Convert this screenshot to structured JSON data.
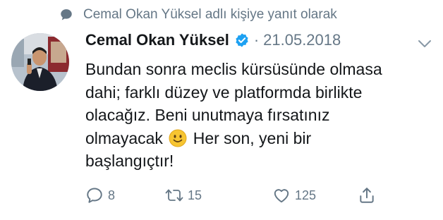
{
  "context": {
    "text": "Cemal Okan Yüksel adlı kişiye yanıt olarak",
    "icon": "speech-bubble-icon"
  },
  "tweet": {
    "author": "Cemal Okan Yüksel",
    "verified": true,
    "separator": "·",
    "date": "21.05.2018",
    "text_before_emoji": "Bundan sonra meclis kürsüsünde olmasa\ndahi; farklı düzey ve platformda birlikte\nolacağız. Beni unutmaya fırsatınız\nolmayacak ",
    "emoji": "slightly-smiling-face-icon",
    "text_after_emoji": " Her son, yeni bir\nbaşlangıçtır!"
  },
  "actions": {
    "reply_count": "8",
    "retweet_count": "15",
    "like_count": "125"
  },
  "colors": {
    "verified": "#1da1f2",
    "muted": "#657786",
    "text": "#14171a",
    "emoji": "#f7c531"
  }
}
